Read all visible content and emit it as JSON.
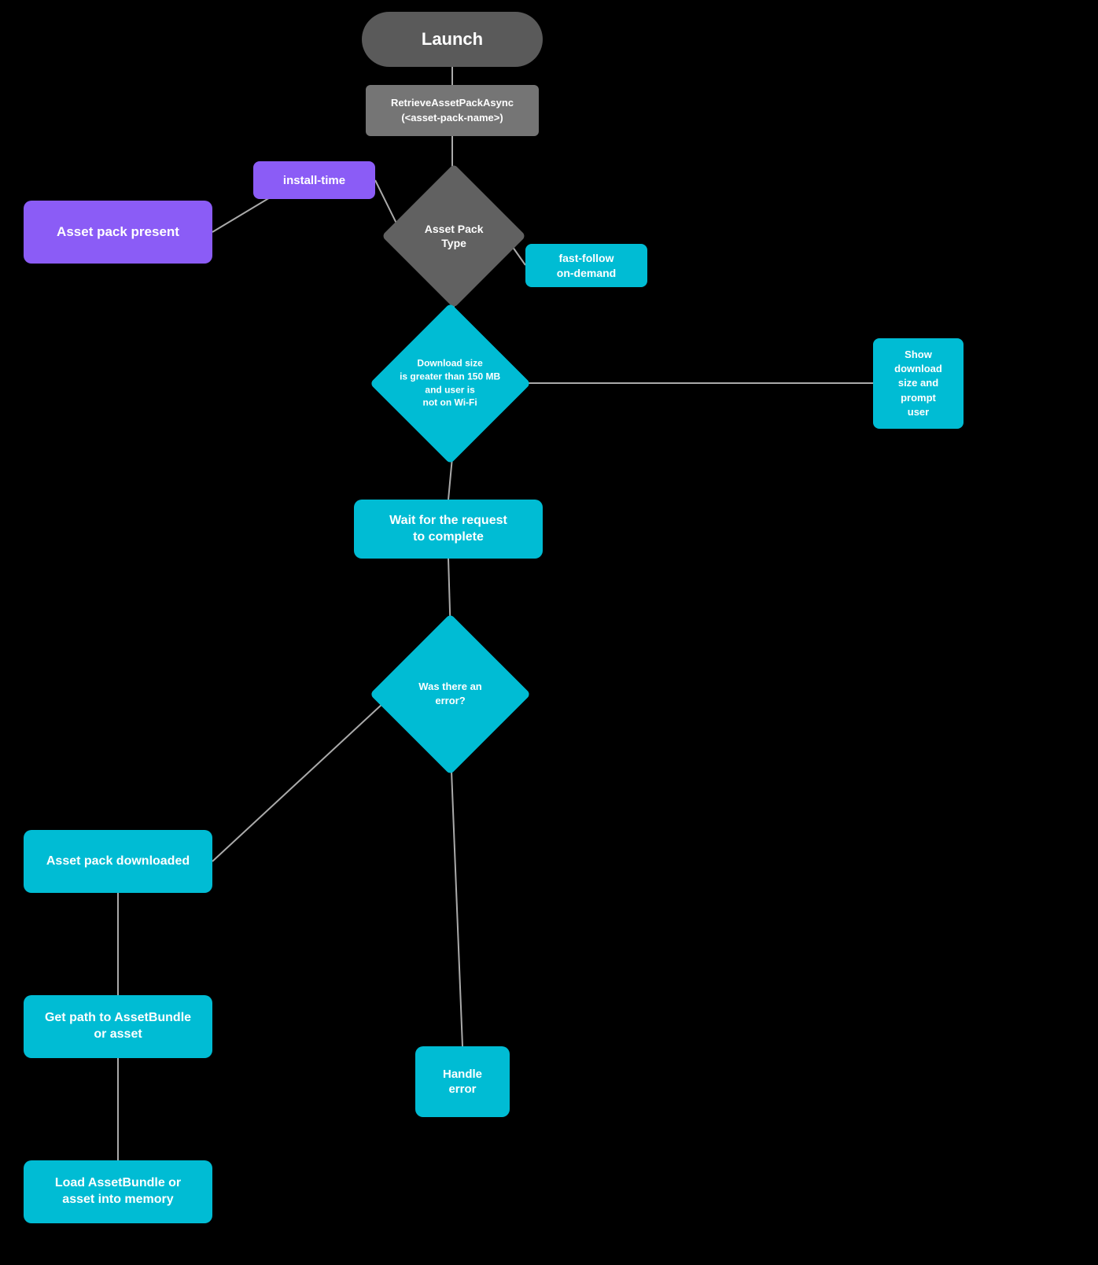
{
  "nodes": {
    "launch": {
      "label": "Launch"
    },
    "retrieve": {
      "label": "RetrieveAssetPackAsync\n(<asset-pack-name>)"
    },
    "install_time": {
      "label": "install-time"
    },
    "asset_pack_type": {
      "label": "Asset Pack\nType"
    },
    "asset_present": {
      "label": "Asset pack present"
    },
    "fast_follow": {
      "label": "fast-follow\non-demand"
    },
    "download_size": {
      "label": "Download size\nis greater than 150 MB\nand user is\nnot on Wi-Fi"
    },
    "show_download": {
      "label": "Show\ndownload\nsize and\nprompt\nuser"
    },
    "wait": {
      "label": "Wait for the request\nto complete"
    },
    "error_diamond": {
      "label": "Was there an\nerror?"
    },
    "asset_downloaded": {
      "label": "Asset pack downloaded"
    },
    "get_path": {
      "label": "Get path to AssetBundle\nor asset"
    },
    "load_asset": {
      "label": "Load AssetBundle or\nasset into memory"
    },
    "handle_error": {
      "label": "Handle\nerror"
    }
  }
}
